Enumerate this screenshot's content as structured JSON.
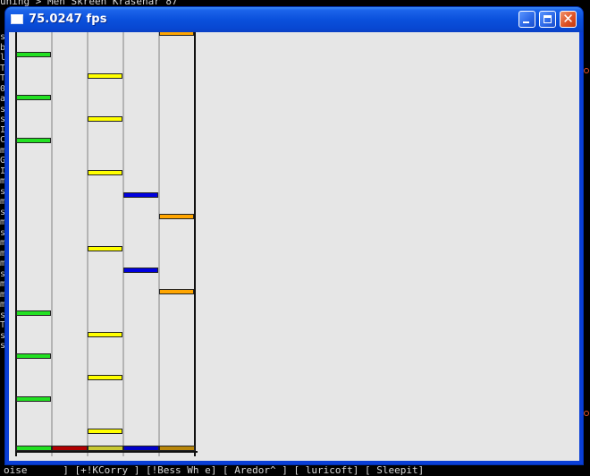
{
  "background": {
    "top_text": "uning > Men Skreen Krasenar 87",
    "bottom_text": "oise      ] [+!KCorry ] [!Bess Wh e] [ Aredor^ ] [ luricoft] [ Sleepit]",
    "left_col_chars": [
      "s",
      "b",
      "l",
      "T",
      "T",
      "0",
      "a",
      "s",
      "s",
      "I",
      "C",
      "m",
      "G",
      "I",
      "m",
      "s",
      "m",
      "s",
      "m",
      "s",
      "m",
      "m",
      "m",
      "s",
      "m",
      "m",
      "m",
      "s",
      "T",
      "s",
      "s"
    ]
  },
  "window": {
    "title": "75.0247 fps",
    "controls": {
      "minimize": "minimize",
      "maximize": "maximize",
      "close": "✕"
    }
  },
  "game": {
    "lane_colors": [
      "#22e022",
      "#b00000",
      "#c8c832",
      "#0000c8",
      "#b8860b"
    ],
    "note_colors": {
      "green": "#22e022",
      "yellow": "#ffff00",
      "blue": "#0000e0",
      "orange": "#ffa500"
    },
    "notes": [
      {
        "lane": 0,
        "color": "green"
      },
      {
        "lane": 2,
        "color": "yellow"
      },
      {
        "lane": 0,
        "color": "green"
      },
      {
        "lane": 2,
        "color": "yellow"
      },
      {
        "lane": 0,
        "color": "green"
      },
      {
        "lane": 2,
        "color": "yellow"
      },
      {
        "lane": 3,
        "color": "blue"
      },
      {
        "lane": 4,
        "color": "orange"
      },
      {
        "lane": 2,
        "color": "yellow"
      },
      {
        "lane": 3,
        "color": "blue"
      },
      {
        "lane": 4,
        "color": "orange"
      },
      {
        "lane": 0,
        "color": "green"
      },
      {
        "lane": 2,
        "color": "yellow"
      },
      {
        "lane": 0,
        "color": "green"
      },
      {
        "lane": 2,
        "color": "yellow"
      },
      {
        "lane": 0,
        "color": "green"
      },
      {
        "lane": 2,
        "color": "yellow"
      },
      {
        "lane": 4,
        "color": "orange"
      }
    ]
  }
}
